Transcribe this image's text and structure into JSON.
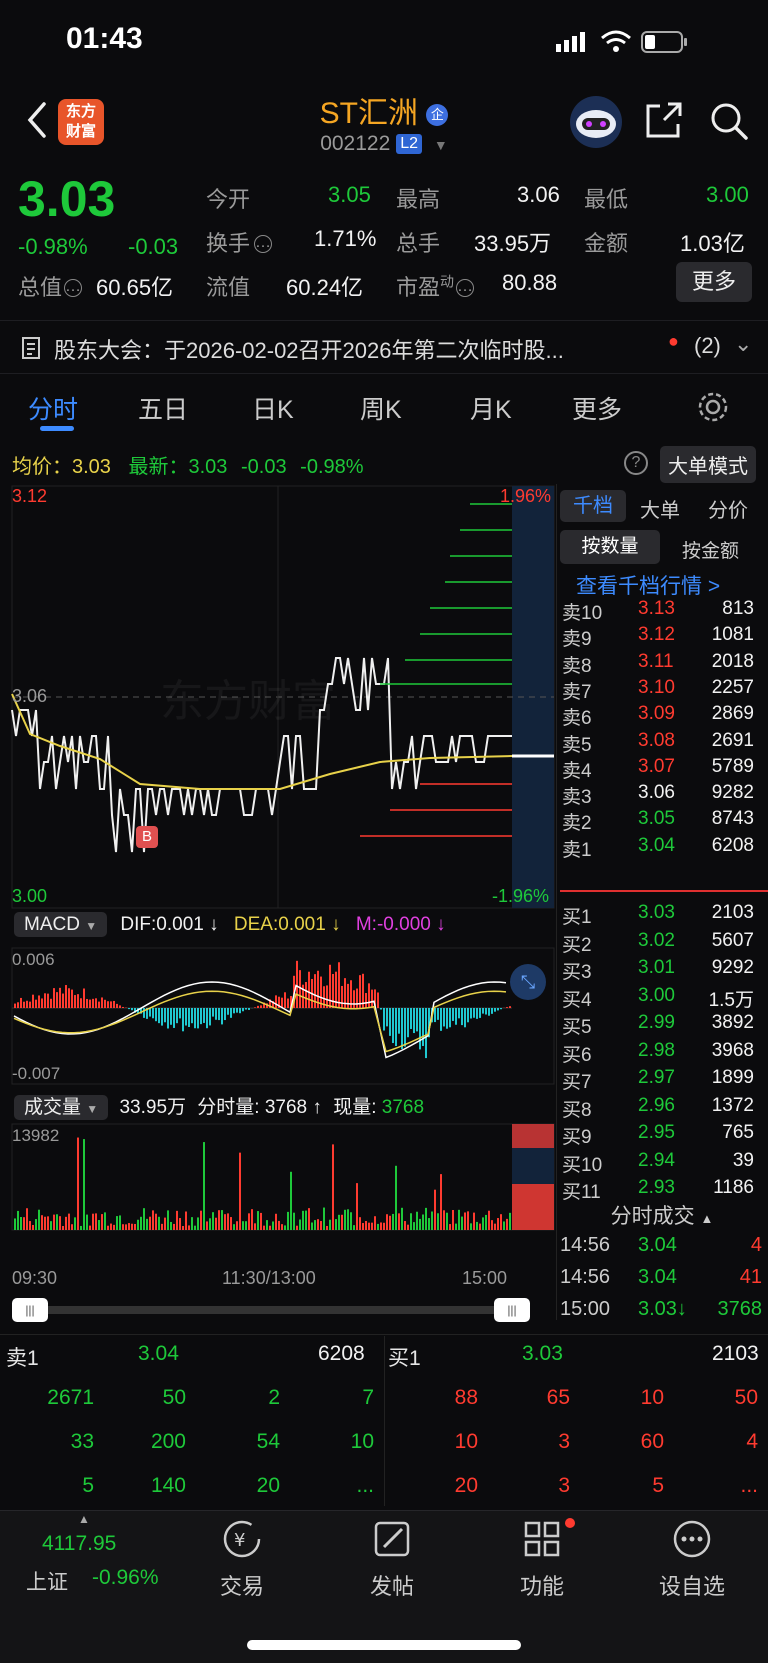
{
  "status_bar": {
    "time": "01:43"
  },
  "header": {
    "logo_text_line1": "东方",
    "logo_text_line2": "财富",
    "stock_name": "ST汇洲",
    "stock_code": "002122",
    "level_badge": "L2",
    "enterprise_badge": "企"
  },
  "quote": {
    "price": "3.03",
    "change_pct": "-0.98%",
    "change": "-0.03",
    "open_label": "今开",
    "open": "3.05",
    "high_label": "最高",
    "high": "3.06",
    "low_label": "最低",
    "low": "3.00",
    "turnover_label": "换手",
    "turnover": "1.71%",
    "volume_label": "总手",
    "volume": "33.95万",
    "amount_label": "金额",
    "amount": "1.03亿",
    "mktcap_label": "总值",
    "mktcap": "60.65亿",
    "float_label": "流值",
    "float": "60.24亿",
    "pe_label": "市盈",
    "pe_sup": "动",
    "pe": "80.88",
    "more_label": "更多"
  },
  "notice": {
    "text": "股东大会：于2026-02-02召开2026年第二次临时股...",
    "count": "(2)"
  },
  "tabs": [
    {
      "label": "分时"
    },
    {
      "label": "五日"
    },
    {
      "label": "日K"
    },
    {
      "label": "周K"
    },
    {
      "label": "月K"
    },
    {
      "label": "更多"
    }
  ],
  "chart_header": {
    "avg_label": "均价：",
    "avg": "3.03",
    "last_label": "最新：",
    "last": "3.03",
    "last_chg": "-0.03",
    "last_pct": "-0.98%",
    "big_order_mode": "大单模式"
  },
  "price_axis": {
    "top": "3.12",
    "mid": "3.06",
    "bottom": "3.00",
    "top_pct": "1.96%",
    "bottom_pct": "-1.96%",
    "marker": "B"
  },
  "macd": {
    "label": "MACD",
    "dif": "DIF:0.001 ↓",
    "dea": "DEA:0.001 ↓",
    "m": "M:-0.000 ↓",
    "top": "0.006",
    "bottom": "-0.007"
  },
  "volume": {
    "label": "成交量",
    "total": "33.95万",
    "minute_label": "分时量:",
    "minute": "3768 ↑",
    "now_label": "现量:",
    "now": "3768",
    "max": "13982"
  },
  "time_axis": [
    "09:30",
    "11:30/13:00",
    "15:00"
  ],
  "watermark": "东方财富",
  "orderbook_tabs": [
    "千档",
    "大单",
    "分价"
  ],
  "orderbook_modes": [
    "按数量",
    "按金额"
  ],
  "orderbook_link": "查看千档行情 >",
  "asks": [
    {
      "label": "卖10",
      "price": "3.13",
      "qty": "813"
    },
    {
      "label": "卖9",
      "price": "3.12",
      "qty": "1081"
    },
    {
      "label": "卖8",
      "price": "3.11",
      "qty": "2018"
    },
    {
      "label": "卖7",
      "price": "3.10",
      "qty": "2257"
    },
    {
      "label": "卖6",
      "price": "3.09",
      "qty": "2869"
    },
    {
      "label": "卖5",
      "price": "3.08",
      "qty": "2691"
    },
    {
      "label": "卖4",
      "price": "3.07",
      "qty": "5789"
    },
    {
      "label": "卖3",
      "price": "3.06",
      "qty": "9282"
    },
    {
      "label": "卖2",
      "price": "3.05",
      "qty": "8743"
    },
    {
      "label": "卖1",
      "price": "3.04",
      "qty": "6208"
    }
  ],
  "bids": [
    {
      "label": "买1",
      "price": "3.03",
      "qty": "2103"
    },
    {
      "label": "买2",
      "price": "3.02",
      "qty": "5607"
    },
    {
      "label": "买3",
      "price": "3.01",
      "qty": "9292"
    },
    {
      "label": "买4",
      "price": "3.00",
      "qty": "1.5万"
    },
    {
      "label": "买5",
      "price": "2.99",
      "qty": "3892"
    },
    {
      "label": "买6",
      "price": "2.98",
      "qty": "3968"
    },
    {
      "label": "买7",
      "price": "2.97",
      "qty": "1899"
    },
    {
      "label": "买8",
      "price": "2.96",
      "qty": "1372"
    },
    {
      "label": "买9",
      "price": "2.95",
      "qty": "765"
    },
    {
      "label": "买10",
      "price": "2.94",
      "qty": "39"
    },
    {
      "label": "买11",
      "price": "2.93",
      "qty": "1186"
    }
  ],
  "ticks_header": "分时成交",
  "ticks": [
    {
      "time": "14:56",
      "price": "3.04",
      "qty": "4"
    },
    {
      "time": "14:56",
      "price": "3.04",
      "qty": "41"
    },
    {
      "time": "15:00",
      "price": "3.03↓",
      "qty": "3768"
    }
  ],
  "queue": {
    "ask_label": "卖1",
    "ask_price": "3.04",
    "ask_qty": "6208",
    "bid_label": "买1",
    "bid_price": "3.03",
    "bid_qty": "2103",
    "ask_rows": [
      [
        "2671",
        "50",
        "2",
        "7"
      ],
      [
        "33",
        "200",
        "54",
        "10"
      ],
      [
        "5",
        "140",
        "20",
        "..."
      ]
    ],
    "bid_rows": [
      [
        "88",
        "65",
        "10",
        "50"
      ],
      [
        "10",
        "3",
        "60",
        "4"
      ],
      [
        "20",
        "3",
        "5",
        "..."
      ]
    ]
  },
  "bottom_nav": {
    "index_value": "4117.95",
    "index_name": "上证",
    "index_pct": "-0.96%",
    "items": [
      {
        "label": "交易"
      },
      {
        "label": "发帖"
      },
      {
        "label": "功能"
      },
      {
        "label": "设自选"
      }
    ]
  },
  "colors": {
    "up": "#ff3b30",
    "down": "#1ec93a",
    "accent": "#3d8bff",
    "brand": "#f5a623"
  }
}
